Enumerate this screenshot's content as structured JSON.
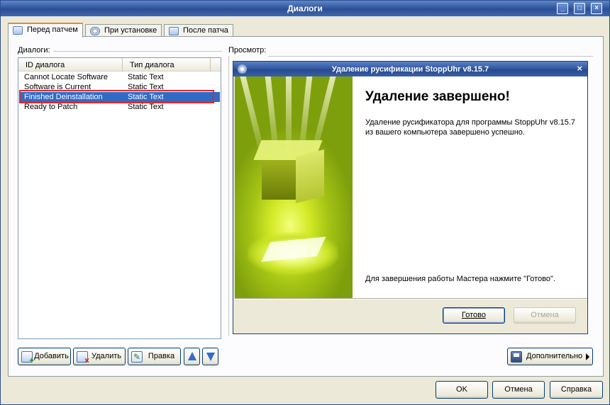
{
  "window": {
    "title": "Диалоги",
    "controls": {
      "minimize": "_",
      "maximize": "□",
      "close": "×"
    }
  },
  "tabs": [
    {
      "label": "Перед патчем",
      "active": true
    },
    {
      "label": "При установке",
      "active": false
    },
    {
      "label": "После патча",
      "active": false
    }
  ],
  "dialogs_panel": {
    "label": "Диалоги:",
    "columns": [
      "ID диалога",
      "Тип диалога"
    ],
    "rows": [
      {
        "id": "Cannot Locate Software",
        "type": "Static Text"
      },
      {
        "id": "Software is Current",
        "type": "Static Text"
      },
      {
        "id": "Finished Deinstallation",
        "type": "Static Text"
      },
      {
        "id": "Ready to Patch",
        "type": "Static Text"
      }
    ],
    "selected_index": 2
  },
  "preview_panel": {
    "label": "Просмотр:",
    "dialog": {
      "title": "Удаление русификации StoppUhr v8.15.7",
      "close": "×",
      "heading": "Удаление завершено!",
      "body": "Удаление русификатора для программы StoppUhr v8.15.7 из вашего компьютера завершено успешно.",
      "footer": "Для завершения работы Мастера нажмите \"Готово\".",
      "buttons": {
        "finish": "Готово",
        "cancel": "Отмена"
      }
    }
  },
  "toolbar": {
    "add": "Добавить",
    "delete": "Удалить",
    "edit": "Правка",
    "more": "Дополнительно"
  },
  "footer_buttons": {
    "ok": "OK",
    "cancel": "Отмена",
    "help": "Справка"
  },
  "colors": {
    "selection": "#316ac5",
    "highlight_border": "#e32626",
    "titlebar": "#2b4f95",
    "arrow": "#2f6cd0"
  }
}
